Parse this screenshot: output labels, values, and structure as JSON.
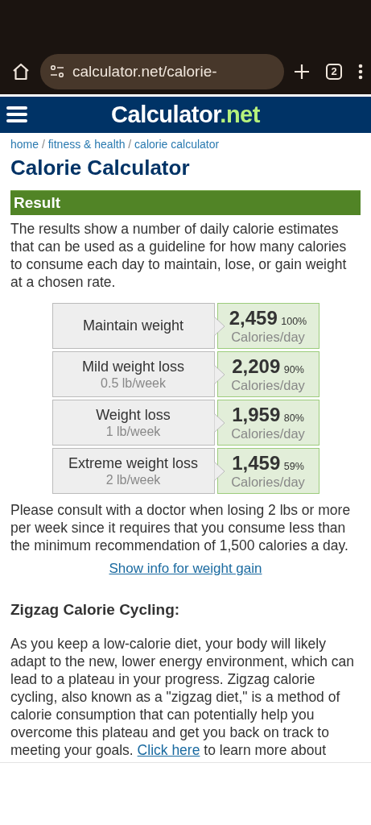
{
  "browser": {
    "url": "calculator.net/calorie-",
    "tab_count": "2"
  },
  "site": {
    "logo_name": "Calculator",
    "logo_tld": ".net"
  },
  "breadcrumb": {
    "separator": "/",
    "items": [
      "home",
      "fitness & health",
      "calorie calculator"
    ]
  },
  "title": "Calorie Calculator",
  "result": {
    "heading": "Result",
    "intro": "The results show a number of daily calorie estimates that can be used as a guideline for how many calories to consume each day to maintain, lose, or gain weight at a chosen rate.",
    "rows": [
      {
        "label": "Maintain weight",
        "calories": "2,459",
        "percent": "100%",
        "unit": "Calories/day"
      },
      {
        "label": "Mild weight loss",
        "rate": "0.5 lb/week",
        "calories": "2,209",
        "percent": "90%",
        "unit": "Calories/day"
      },
      {
        "label": "Weight loss",
        "rate": "1 lb/week",
        "calories": "1,959",
        "percent": "80%",
        "unit": "Calories/day"
      },
      {
        "label": "Extreme weight loss",
        "rate": "2 lb/week",
        "calories": "1,459",
        "percent": "59%",
        "unit": "Calories/day"
      }
    ],
    "note": "Please consult with a doctor when losing 2 lbs or more per week since it requires that you consume less than the minimum recommendation of 1,500 calories a day.",
    "gain_link": "Show info for weight gain"
  },
  "zigzag": {
    "heading": "Zigzag Calorie Cycling:",
    "text_before": "As you keep a low-calorie diet, your body will likely adapt to the new, lower energy environment, which can lead to a plateau in your progress. Zigzag calorie cycling, also known as a \"zigzag diet,\" is a method of calorie consumption that can potentially help you overcome this plateau and get you back on track to meeting your goals.",
    "link": "Click here",
    "text_after": "to learn more about"
  }
}
